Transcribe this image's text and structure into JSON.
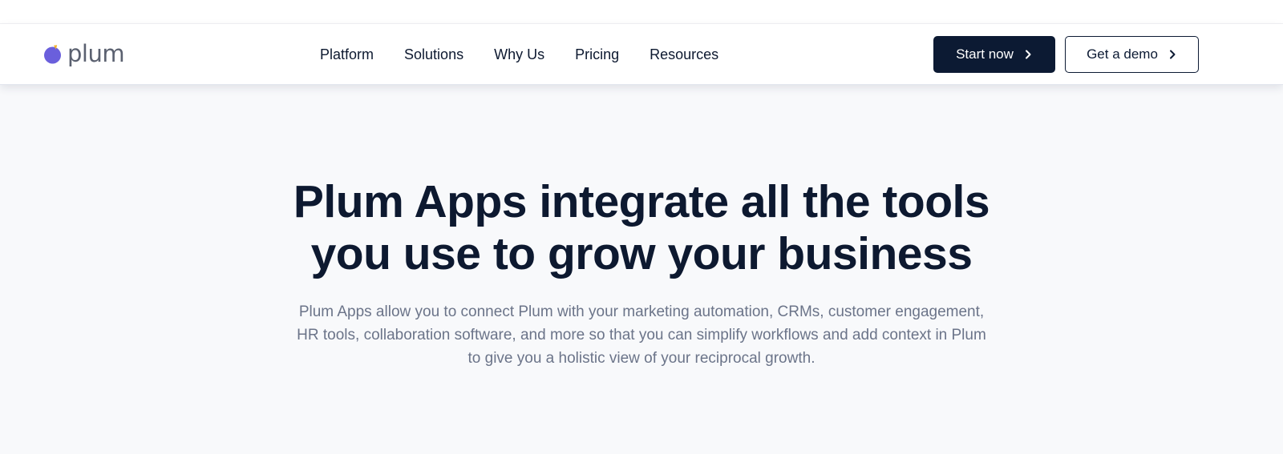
{
  "brand": {
    "name": "plum",
    "mark_color": "#6a5fdc",
    "mark_accent_color": "#f5b32a"
  },
  "nav": {
    "items": [
      {
        "label": "Platform"
      },
      {
        "label": "Solutions"
      },
      {
        "label": "Why Us"
      },
      {
        "label": "Pricing"
      },
      {
        "label": "Resources"
      }
    ],
    "cta_primary": {
      "label": "Start now",
      "icon": "chevron-right-icon"
    },
    "cta_secondary": {
      "label": "Get a demo",
      "icon": "chevron-right-icon"
    }
  },
  "hero": {
    "title_line1": "Plum Apps integrate all the tools",
    "title_line2": "you use to grow your business",
    "subtitle_line1": "Plum Apps allow you to connect Plum with your marketing automation, CRMs, customer engagement,",
    "subtitle_line2": "HR tools, collaboration software, and more so that you can simplify workflows and add context in Plum",
    "subtitle_line3": "to give you a holistic view of your reciprocal growth."
  },
  "colors": {
    "navy": "#0c1a33",
    "body_text": "#6b7489",
    "page_bg": "#f8f9fb"
  }
}
